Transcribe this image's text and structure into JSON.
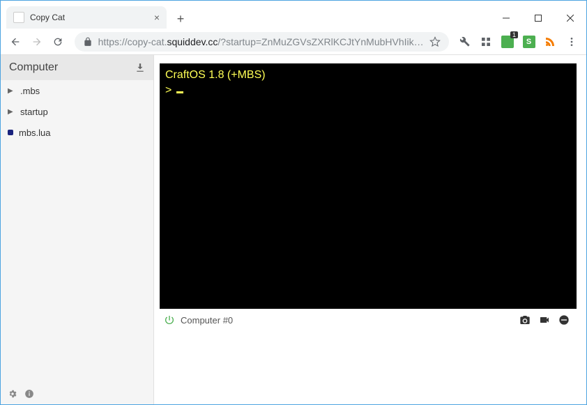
{
  "window": {
    "tab_title": "Copy Cat"
  },
  "address": {
    "protocol": "https://",
    "sub": "copy-cat.",
    "host": "squiddev.cc",
    "path": "/?startup=ZnMuZGVsZXRlKCJtYnMubHVhIik…"
  },
  "extensions": {
    "badge_count": "1",
    "s_label": "S"
  },
  "sidebar": {
    "title": "Computer",
    "items": [
      {
        "type": "folder",
        "name": ".mbs"
      },
      {
        "type": "folder",
        "name": "startup"
      },
      {
        "type": "file",
        "name": "mbs.lua"
      }
    ]
  },
  "terminal": {
    "line1": "CraftOS 1.8 (+MBS)",
    "line2": "> "
  },
  "status": {
    "label": "Computer #0"
  }
}
